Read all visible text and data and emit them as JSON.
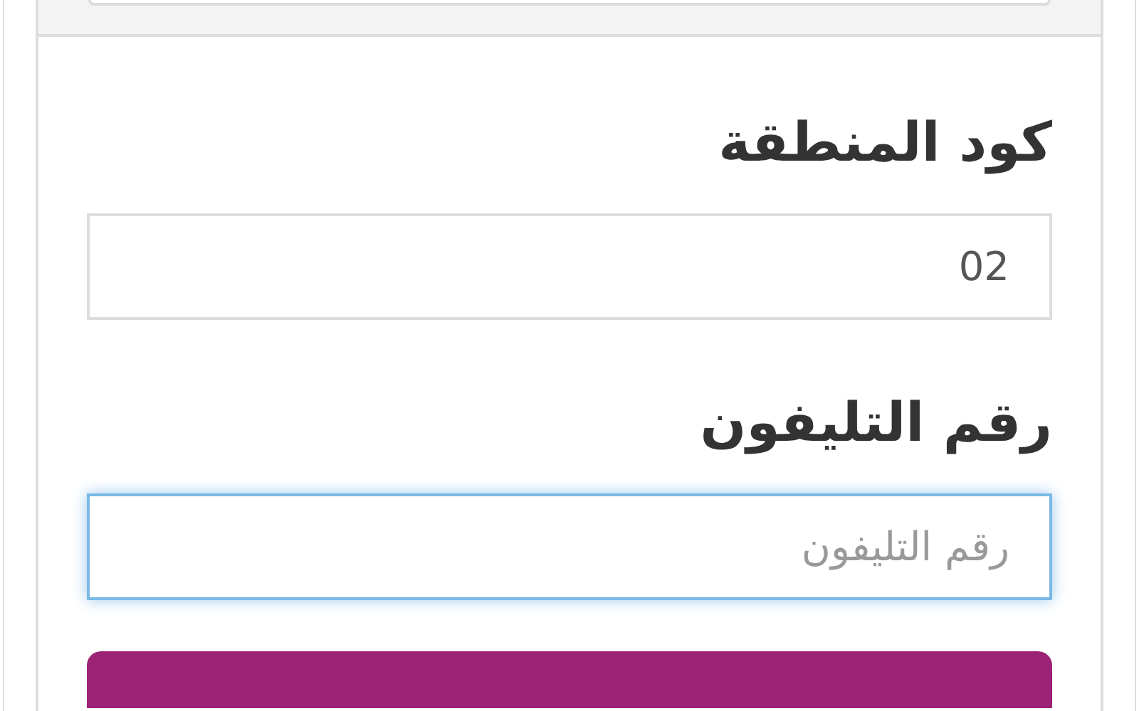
{
  "fields": [
    {
      "label": "كود المنطقة",
      "value": "02",
      "focused": false
    },
    {
      "label": "رقم التليفون",
      "placeholder": "رقم التليفون",
      "focused": true
    }
  ]
}
